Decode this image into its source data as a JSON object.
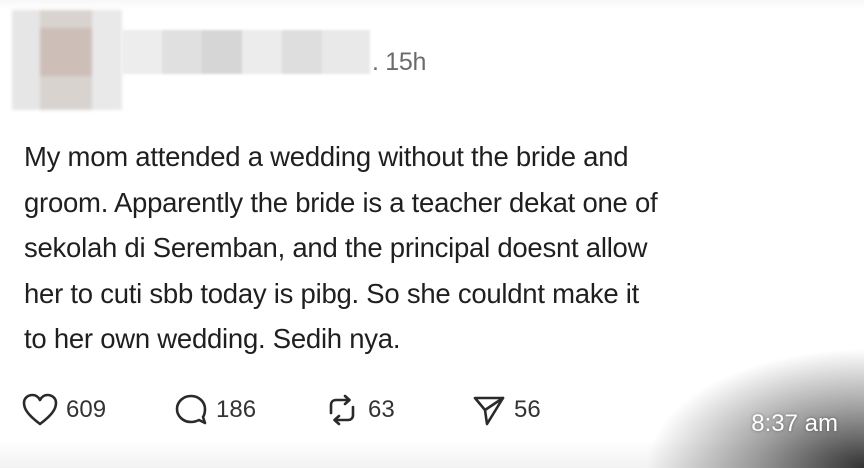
{
  "post": {
    "timestamp": ". 15h",
    "lines": [
      "My mom attended a wedding without the bride and",
      "groom. Apparently the bride is a teacher dekat one of",
      "sekolah di Seremban, and the principal doesnt allow",
      "her to cuti sbb today is pibg. So she couldnt make it",
      "to her own wedding. Sedih nya."
    ]
  },
  "actions": {
    "likes": {
      "icon": "heart-icon",
      "count": "609"
    },
    "replies": {
      "icon": "comment-icon",
      "count": "186"
    },
    "reposts": {
      "icon": "repost-icon",
      "count": "63"
    },
    "shares": {
      "icon": "send-icon",
      "count": "56"
    }
  },
  "status": {
    "clock": "8:37 am"
  }
}
